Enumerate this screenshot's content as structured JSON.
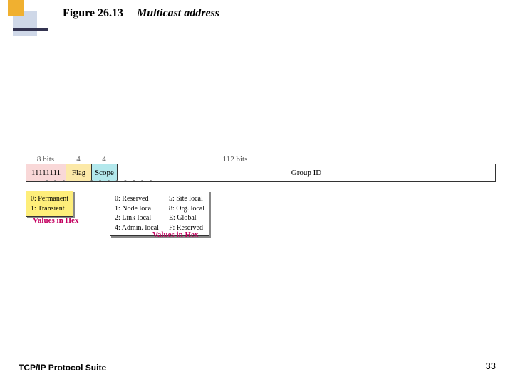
{
  "header": {
    "fig_label": "Figure 26.13",
    "fig_title": "Multicast address"
  },
  "bits": {
    "prefix": "8 bits",
    "flag": "4",
    "scope": "4",
    "group": "112 bits"
  },
  "fields": {
    "prefix": "11111111",
    "flag": "Flag",
    "scope": "Scope",
    "group": "Group ID"
  },
  "flag_box": {
    "line1": "0: Permanent",
    "line2": "1: Transient"
  },
  "scope_box": {
    "col1": "0: Reserved\n1: Node local\n2: Link local\n4: Admin. local",
    "col2": "5: Site local\n8: Org. local\nE: Global\nF: Reserved"
  },
  "labels": {
    "values_in_hex": "Values in Hex"
  },
  "footer": {
    "suite": "TCP/IP Protocol Suite",
    "page": "33"
  }
}
